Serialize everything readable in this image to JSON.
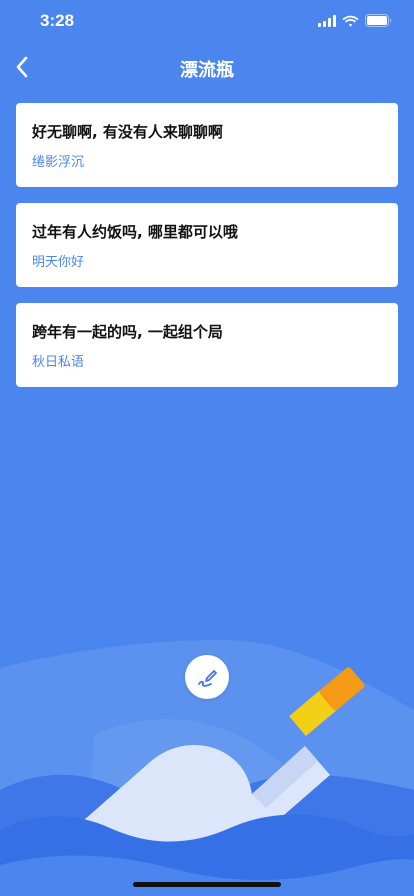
{
  "status": {
    "time": "3:28"
  },
  "nav": {
    "title": "漂流瓶"
  },
  "bottles": [
    {
      "message": "好无聊啊, 有没有人来聊聊啊",
      "user": "绻影浮沉"
    },
    {
      "message": "过年有人约饭吗, 哪里都可以哦",
      "user": "明天你好"
    },
    {
      "message": "跨年有一起的吗, 一起组个局",
      "user": "秋日私语"
    }
  ],
  "icons": {
    "back": "chevron-left-icon",
    "write": "pen-write-icon",
    "signal": "cellular-signal-icon",
    "wifi": "wifi-icon",
    "battery": "battery-icon"
  },
  "colors": {
    "background": "#4a86ee",
    "accent_text": "#4a86ee",
    "card": "#ffffff"
  }
}
